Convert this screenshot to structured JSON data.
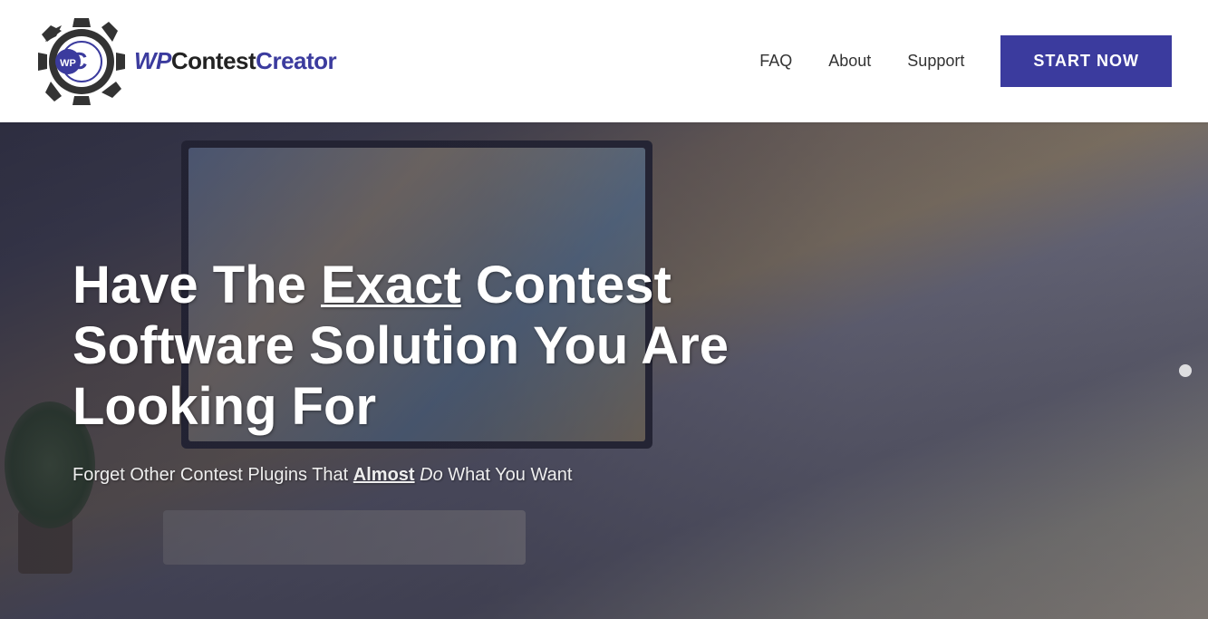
{
  "header": {
    "logo_text_wp": "WP",
    "logo_text_contest": "Contest",
    "logo_text_creator": "Creator",
    "nav": {
      "faq_label": "FAQ",
      "about_label": "About",
      "support_label": "Support",
      "start_now_label": "START NOW"
    }
  },
  "hero": {
    "headline_part1": "Have The ",
    "headline_exact": "Exact",
    "headline_part2": " Contest Software Solution You Are Looking For",
    "subtext_part1": "Forget Other Contest Plugins That ",
    "subtext_almost": "Almost",
    "subtext_part2": " ",
    "subtext_do": "Do",
    "subtext_part3": " What You Want"
  }
}
